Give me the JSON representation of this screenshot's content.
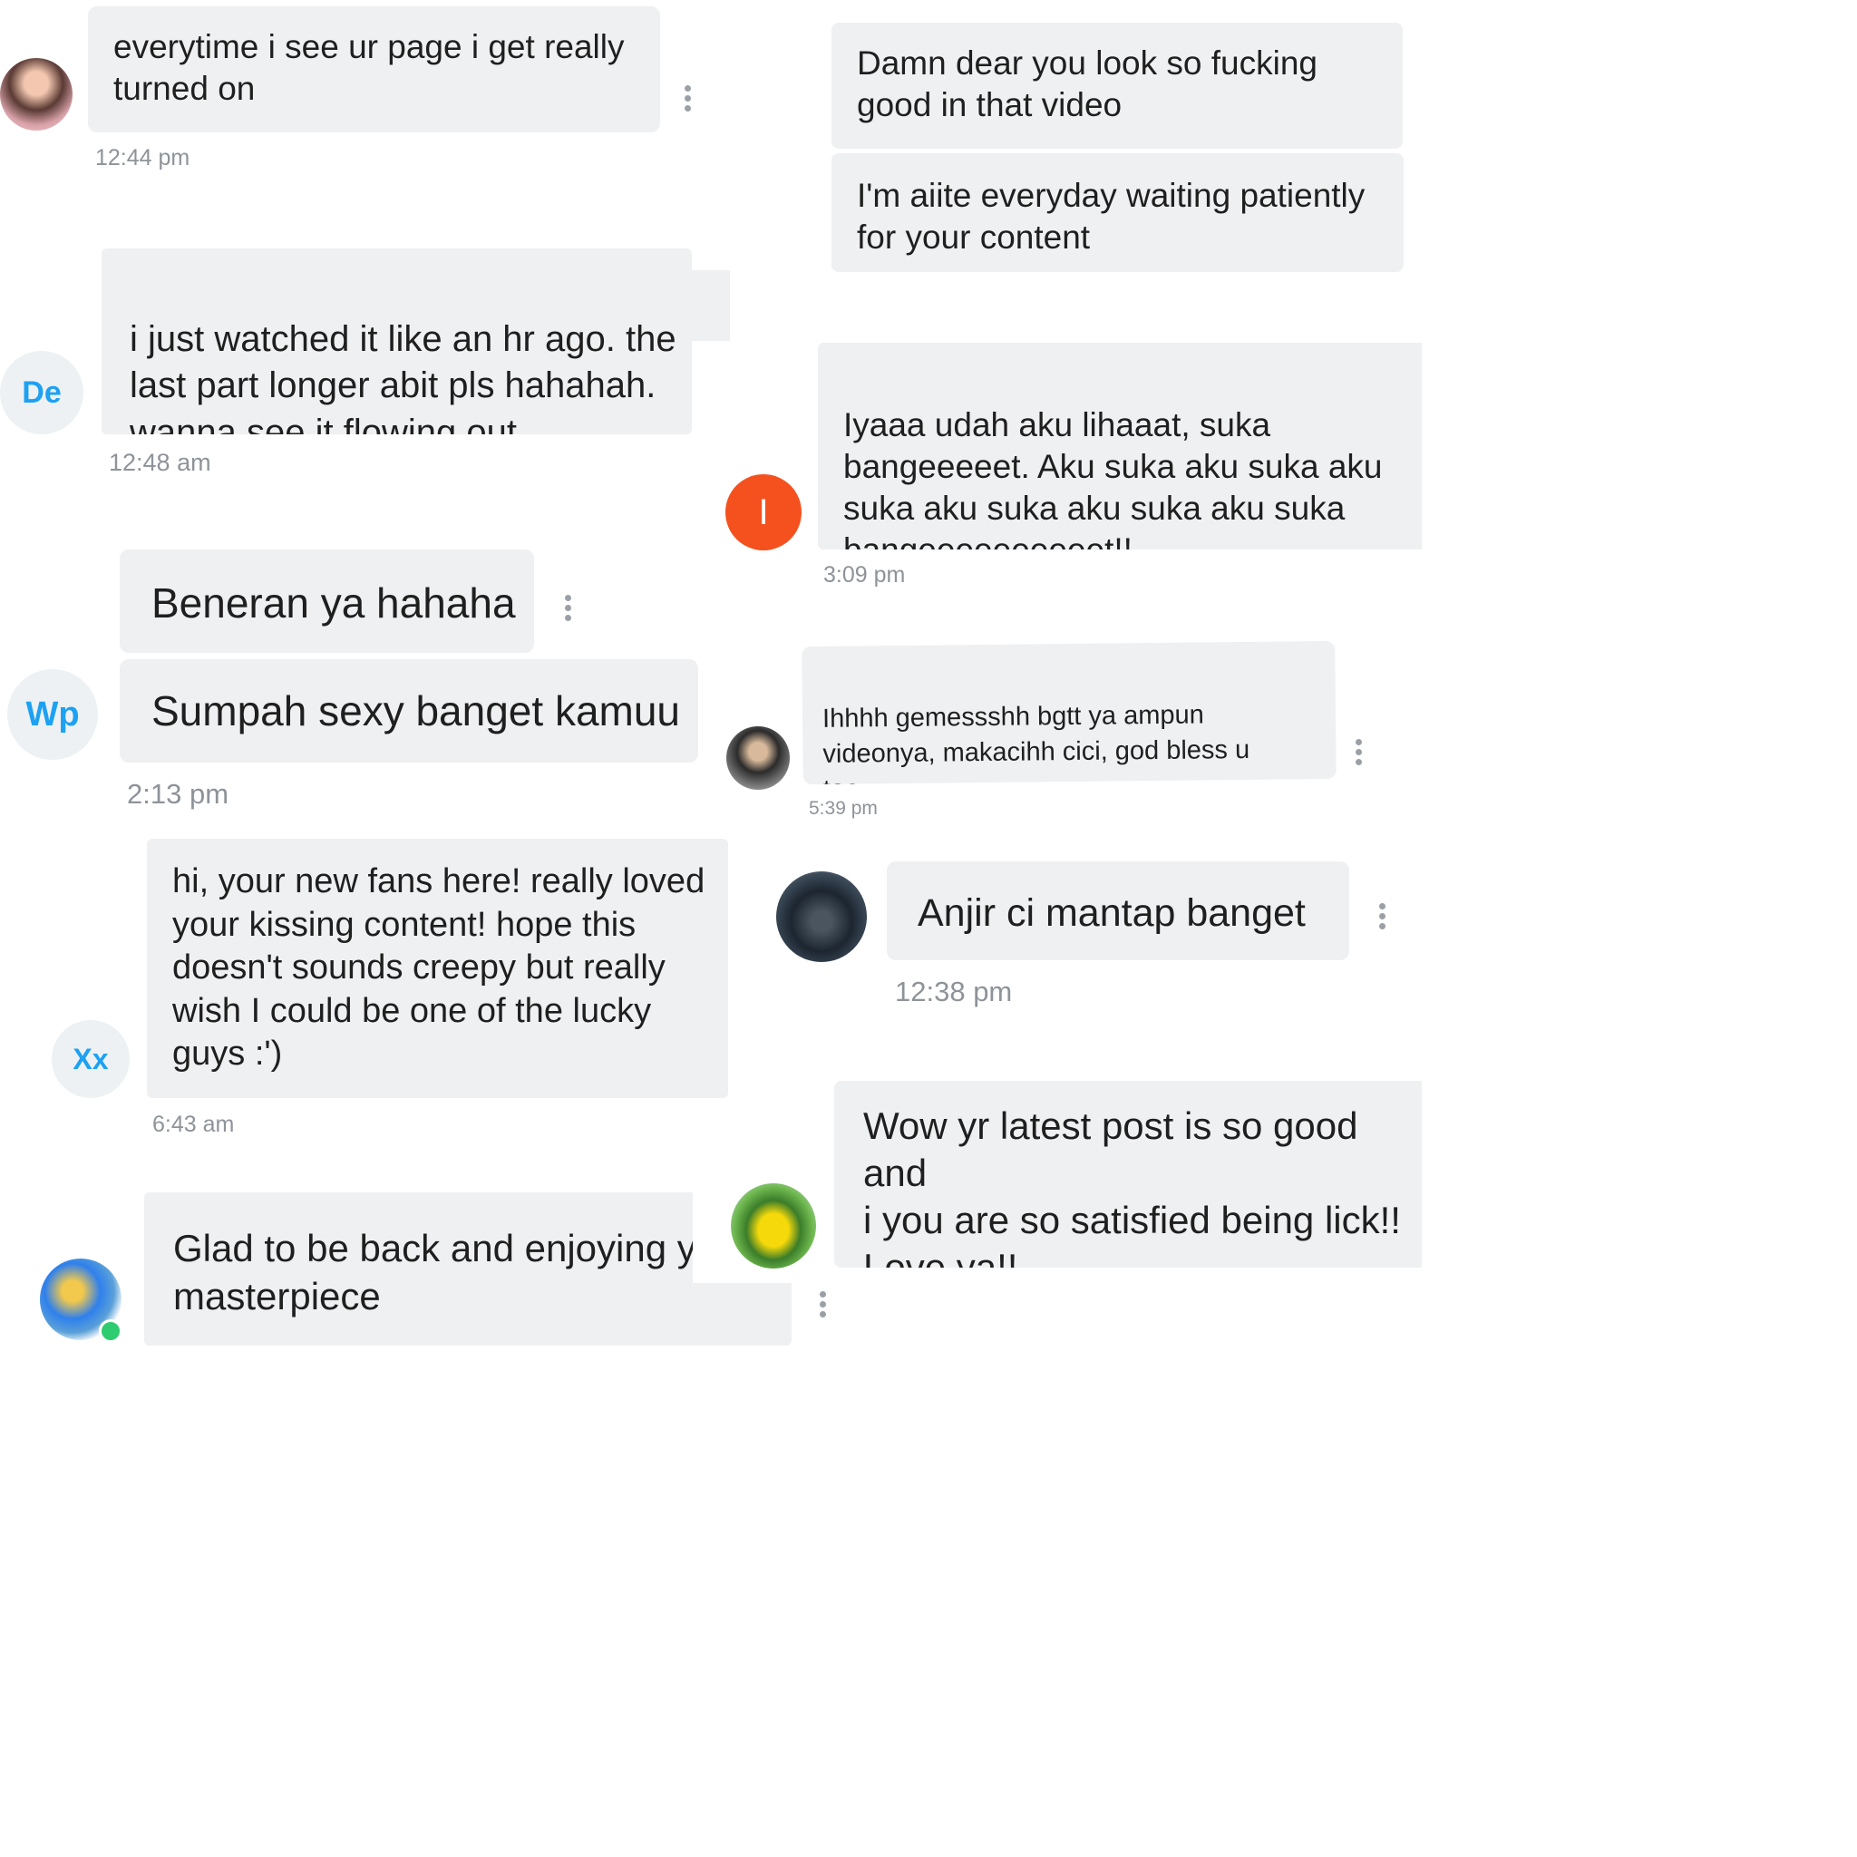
{
  "threads": [
    {
      "avatar_text": "",
      "messages": [
        "everytime i see ur page i get really\nturned on"
      ],
      "time": "12:44 pm"
    },
    {
      "avatar_text": "De",
      "messages": [
        "i just watched it like an hr ago. the\nlast part longer abit pls hahahah.\nwanna see it flowing out"
      ],
      "time": "12:48 am"
    },
    {
      "avatar_text": "Wp",
      "messages": [
        "Beneran ya hahaha",
        "Sumpah sexy banget kamuu"
      ],
      "time": "2:13 pm"
    },
    {
      "avatar_text": "Xx",
      "messages": [
        "hi, your new fans here! really loved\nyour kissing content! hope this\ndoesn't sounds creepy but really\nwish I could be one of the lucky\nguys :')"
      ],
      "time": "6:43 am"
    },
    {
      "avatar_text": "",
      "messages": [
        "Glad to be back and enjoying y\nmasterpiece"
      ],
      "time": ""
    },
    {
      "avatar_text": "",
      "messages": [
        "Damn dear you look so fucking\ngood in that video",
        "I'm aiite everyday waiting patiently\nfor your content"
      ],
      "time": ""
    },
    {
      "avatar_text": "I",
      "messages": [
        "Iyaaa udah aku lihaaat, suka\nbangeeeeet. Aku suka aku suka aku\nsuka aku suka aku suka aku suka\nbangeeeeeeeeeet!!"
      ],
      "time": "3:09 pm"
    },
    {
      "avatar_text": "",
      "messages": [
        "Ihhhh gemessshh bgtt ya ampun\nvideonya, makacihh cici, god bless u\ntoo"
      ],
      "time": "5:39 pm"
    },
    {
      "avatar_text": "",
      "messages": [
        "Anjir ci mantap banget"
      ],
      "time": "12:38 pm"
    },
    {
      "avatar_text": "",
      "messages": [
        "Wow yr latest post is so good and\ni you are so satisfied being lick!!\nLove ya!!"
      ],
      "time": ""
    }
  ],
  "colors": {
    "bubble": "#eff0f2",
    "initials": "#1da1f2",
    "orange_avatar": "#f4511e",
    "timestamp": "#8e939a"
  },
  "icons": [
    "more-vertical-icon",
    "hand-over-mouth-emoji",
    "smiley-emoji",
    "fire-emoji",
    "red-heart-emoji",
    "smiling-face-with-hearts-emoji"
  ]
}
